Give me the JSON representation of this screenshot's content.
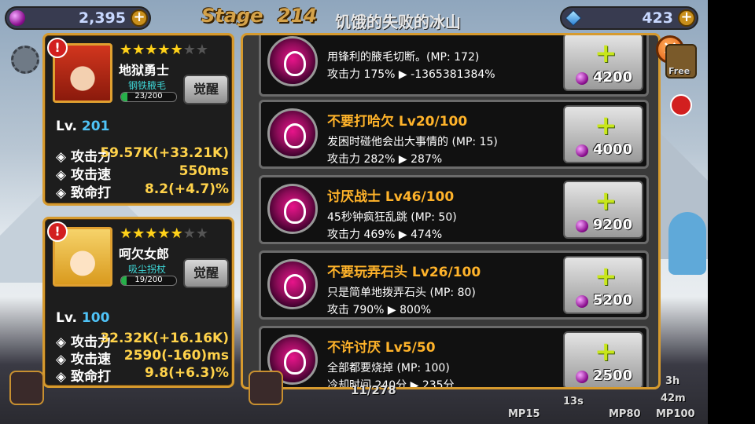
{
  "top_bar": {
    "gold": "2,395",
    "stage_label": "Stage",
    "stage_number": "214",
    "stage_name": "饥饿的失败的冰山",
    "diamonds": "423"
  },
  "heroes": [
    {
      "name": "地狱勇士",
      "stars_total": 7,
      "stars_filled": 5,
      "weapon": "钢铁腋毛",
      "exp": "23/200",
      "exp_fraction": 0.115,
      "awaken": "觉醒",
      "level_label": "Lv.",
      "level": "201",
      "stats": [
        {
          "label": "◈ 攻击力",
          "value": "59.57K(+33.21K)"
        },
        {
          "label": "◈ 攻击速",
          "value": "550ms"
        },
        {
          "label": "◈ 致命打",
          "value": "8.2(+4.7)%"
        }
      ]
    },
    {
      "name": "呵欠女郎",
      "stars_total": 7,
      "stars_filled": 5,
      "weapon": "吸尘拐杖",
      "exp": "19/200",
      "exp_fraction": 0.095,
      "awaken": "觉醒",
      "level_label": "Lv.",
      "level": "100",
      "stats": [
        {
          "label": "◈ 攻击力",
          "value": "32.32K(+16.16K)"
        },
        {
          "label": "◈ 攻击速",
          "value": "2590(-160)ms"
        },
        {
          "label": "◈ 致命打",
          "value": "9.8(+6.3)%"
        }
      ]
    }
  ],
  "skills": [
    {
      "title": "",
      "desc": "用锋利的腋毛切断。(MP: 172)",
      "value": "攻击力 175% ▶ -1365381384%",
      "cost": "4200"
    },
    {
      "title": "不要打哈欠 Lv20/100",
      "desc": "发困时碰他会出大事情的 (MP: 15)",
      "value": "攻击力 282% ▶ 287%",
      "cost": "4000"
    },
    {
      "title": "讨厌战士 Lv46/100",
      "desc": "45秒钟疯狂乱跳 (MP: 50)",
      "value": "攻击力 469% ▶ 474%",
      "cost": "9200"
    },
    {
      "title": "不要玩弄石头 Lv26/100",
      "desc": "只是简单地拨弄石头 (MP: 80)",
      "value": "攻击 790% ▶ 800%",
      "cost": "5200"
    },
    {
      "title": "不许讨厌 Lv5/50",
      "desc": "全部都要烧掉 (MP: 100)",
      "value": "冷却时间 240分 ▶ 235分",
      "cost": "2500"
    }
  ],
  "icons": {
    "plus_glyph": "+",
    "close_glyph": "✕",
    "alert_glyph": "!"
  },
  "bottom_bar": {
    "progress": "11/278",
    "labels": [
      "MP15",
      "13s",
      "MP80",
      "3h",
      "42m",
      "MP100"
    ],
    "free_label": "Free"
  },
  "colors": {
    "panel_border": "#d69a2e",
    "skill_title": "#ffb32a",
    "level_number": "#4fc3f7",
    "stat_value": "#ffd24a",
    "gem": "#8a0f8e"
  }
}
